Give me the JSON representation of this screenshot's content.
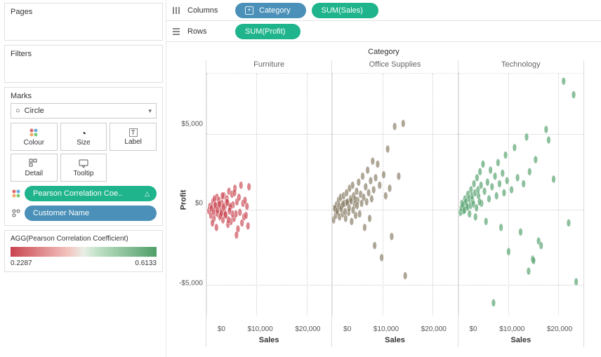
{
  "sidebar": {
    "pages_title": "Pages",
    "filters_title": "Filters",
    "marks_title": "Marks",
    "shape_selected": "Circle",
    "mark_buttons": {
      "colour": "Colour",
      "size": "Size",
      "label": "Label",
      "detail": "Detail",
      "tooltip": "Tooltip"
    },
    "colour_pill": "Pearson Correlation Coe..",
    "detail_pill": "Customer Name",
    "legend_title": "AGG(Pearson Correlation Coefficient)",
    "legend_min": "0.2287",
    "legend_max": "0.6133"
  },
  "shelves": {
    "columns_label": "Columns",
    "rows_label": "Rows",
    "columns_pills": [
      {
        "text": "Category",
        "style": "blue",
        "expand": true
      },
      {
        "text": "SUM(Sales)",
        "style": "green",
        "expand": false
      }
    ],
    "rows_pills": [
      {
        "text": "SUM(Profit)",
        "style": "green",
        "expand": false
      }
    ]
  },
  "viz": {
    "header": "Category",
    "facets": [
      "Furniture",
      "Office Supplies",
      "Technology"
    ],
    "y_title": "Profit",
    "y_ticks": [
      "$5,000",
      "$0",
      "-$5,000"
    ],
    "x_ticks": [
      "$0",
      "$10,000",
      "$20,000"
    ],
    "x_label": "Sales"
  },
  "chart_data": {
    "type": "scatter",
    "title": "Category",
    "xlabel": "Sales",
    "ylabel": "Profit",
    "xlim": [
      0,
      25000
    ],
    "ylim": [
      -7000,
      9000
    ],
    "facet_by": "Category",
    "colour_by": "Pearson Correlation Coefficient",
    "colour_scale": {
      "min": 0.2287,
      "max": 0.6133,
      "low_color": "#c9434f",
      "high_color": "#4f9e68"
    },
    "series": [
      {
        "name": "Furniture",
        "corr": 0.2287,
        "points": [
          [
            500,
            -100
          ],
          [
            700,
            200
          ],
          [
            900,
            -400
          ],
          [
            1100,
            100
          ],
          [
            1300,
            500
          ],
          [
            1500,
            -600
          ],
          [
            1700,
            300
          ],
          [
            1900,
            -200
          ],
          [
            2100,
            800
          ],
          [
            2300,
            -300
          ],
          [
            2500,
            600
          ],
          [
            2700,
            -500
          ],
          [
            2900,
            0
          ],
          [
            3100,
            400
          ],
          [
            3300,
            -700
          ],
          [
            3500,
            900
          ],
          [
            3700,
            200
          ],
          [
            3900,
            -400
          ],
          [
            4100,
            700
          ],
          [
            4300,
            -1000
          ],
          [
            4500,
            1200
          ],
          [
            4700,
            100
          ],
          [
            4900,
            -800
          ],
          [
            5100,
            1000
          ],
          [
            5300,
            300
          ],
          [
            5500,
            -600
          ],
          [
            5700,
            1400
          ],
          [
            5900,
            -300
          ],
          [
            6100,
            500
          ],
          [
            6300,
            -1300
          ],
          [
            6500,
            800
          ],
          [
            6700,
            -200
          ],
          [
            6900,
            1600
          ],
          [
            7100,
            -900
          ],
          [
            7300,
            400
          ],
          [
            7500,
            -500
          ],
          [
            7700,
            600
          ],
          [
            7900,
            -400
          ],
          [
            8100,
            200
          ],
          [
            8300,
            -1100
          ],
          [
            8500,
            1500
          ],
          [
            1200,
            -900
          ],
          [
            1600,
            700
          ],
          [
            2000,
            -1200
          ],
          [
            2400,
            300
          ],
          [
            2800,
            -400
          ],
          [
            3200,
            900
          ],
          [
            3600,
            -200
          ],
          [
            4000,
            500
          ],
          [
            4400,
            -700
          ],
          [
            4800,
            200
          ],
          [
            5200,
            -300
          ],
          [
            5600,
            1100
          ],
          [
            6000,
            -1700
          ],
          [
            1000,
            50
          ],
          [
            1400,
            -150
          ],
          [
            1800,
            250
          ],
          [
            2200,
            -50
          ],
          [
            2600,
            350
          ],
          [
            3000,
            -250
          ],
          [
            3400,
            150
          ],
          [
            3800,
            -350
          ],
          [
            4200,
            450
          ],
          [
            4600,
            -100
          ]
        ]
      },
      {
        "name": "Office Supplies",
        "corr": 0.45,
        "points": [
          [
            300,
            -700
          ],
          [
            500,
            100
          ],
          [
            700,
            -400
          ],
          [
            900,
            300
          ],
          [
            1100,
            -200
          ],
          [
            1300,
            600
          ],
          [
            1500,
            -500
          ],
          [
            1700,
            800
          ],
          [
            1900,
            200
          ],
          [
            2100,
            -300
          ],
          [
            2300,
            900
          ],
          [
            2500,
            400
          ],
          [
            2700,
            -600
          ],
          [
            2900,
            1100
          ],
          [
            3100,
            500
          ],
          [
            3300,
            -200
          ],
          [
            3500,
            1400
          ],
          [
            3700,
            700
          ],
          [
            3900,
            -800
          ],
          [
            4100,
            1600
          ],
          [
            4300,
            900
          ],
          [
            4500,
            300
          ],
          [
            4700,
            -400
          ],
          [
            4900,
            1200
          ],
          [
            5100,
            600
          ],
          [
            5300,
            1800
          ],
          [
            5500,
            -300
          ],
          [
            5700,
            1000
          ],
          [
            5900,
            400
          ],
          [
            6100,
            2200
          ],
          [
            6300,
            800
          ],
          [
            6500,
            -1200
          ],
          [
            6700,
            1500
          ],
          [
            6900,
            500
          ],
          [
            7100,
            2600
          ],
          [
            7300,
            1100
          ],
          [
            7500,
            -600
          ],
          [
            7700,
            1900
          ],
          [
            7900,
            700
          ],
          [
            8100,
            3200
          ],
          [
            8300,
            1300
          ],
          [
            8500,
            -2400
          ],
          [
            8700,
            2100
          ],
          [
            9100,
            3000
          ],
          [
            9500,
            1600
          ],
          [
            9900,
            -3200
          ],
          [
            10300,
            2300
          ],
          [
            10700,
            900
          ],
          [
            11100,
            4000
          ],
          [
            11500,
            1400
          ],
          [
            11900,
            -1800
          ],
          [
            12500,
            5500
          ],
          [
            13300,
            2200
          ],
          [
            14200,
            5700
          ],
          [
            14600,
            -4400
          ],
          [
            600,
            50
          ],
          [
            1000,
            -100
          ],
          [
            1400,
            200
          ],
          [
            1800,
            50
          ],
          [
            2200,
            350
          ],
          [
            2600,
            -150
          ],
          [
            3000,
            450
          ],
          [
            3400,
            100
          ],
          [
            3800,
            550
          ],
          [
            4200,
            -50
          ],
          [
            4600,
            650
          ],
          [
            5000,
            250
          ]
        ]
      },
      {
        "name": "Technology",
        "corr": 0.6133,
        "points": [
          [
            400,
            -200
          ],
          [
            700,
            400
          ],
          [
            1000,
            -100
          ],
          [
            1300,
            700
          ],
          [
            1600,
            200
          ],
          [
            1900,
            1000
          ],
          [
            2200,
            -300
          ],
          [
            2500,
            1300
          ],
          [
            2800,
            600
          ],
          [
            3100,
            1700
          ],
          [
            3400,
            -500
          ],
          [
            3700,
            2100
          ],
          [
            4000,
            900
          ],
          [
            4300,
            2500
          ],
          [
            4600,
            400
          ],
          [
            4900,
            3000
          ],
          [
            5200,
            1200
          ],
          [
            5500,
            -800
          ],
          [
            5800,
            1800
          ],
          [
            6100,
            700
          ],
          [
            6400,
            2600
          ],
          [
            6700,
            1500
          ],
          [
            7000,
            -6200
          ],
          [
            7300,
            2200
          ],
          [
            7600,
            900
          ],
          [
            7900,
            3100
          ],
          [
            8200,
            1700
          ],
          [
            8500,
            -1200
          ],
          [
            8800,
            2400
          ],
          [
            9100,
            1100
          ],
          [
            9400,
            3600
          ],
          [
            9700,
            1900
          ],
          [
            10000,
            -2800
          ],
          [
            10600,
            1300
          ],
          [
            11200,
            4100
          ],
          [
            11800,
            2100
          ],
          [
            12400,
            -1500
          ],
          [
            13000,
            1700
          ],
          [
            13600,
            4800
          ],
          [
            14200,
            2500
          ],
          [
            14800,
            -3300
          ],
          [
            15400,
            3300
          ],
          [
            16000,
            -2100
          ],
          [
            17500,
            5300
          ],
          [
            19000,
            2000
          ],
          [
            21000,
            8500
          ],
          [
            22000,
            -900
          ],
          [
            23000,
            7600
          ],
          [
            23500,
            -4800
          ],
          [
            14000,
            -4100
          ],
          [
            15000,
            -3400
          ],
          [
            16500,
            -2400
          ],
          [
            18000,
            4600
          ],
          [
            600,
            100
          ],
          [
            900,
            300
          ],
          [
            1200,
            -50
          ],
          [
            1500,
            500
          ],
          [
            1800,
            150
          ],
          [
            2100,
            700
          ],
          [
            2400,
            250
          ],
          [
            2700,
            900
          ],
          [
            3000,
            350
          ],
          [
            3300,
            1100
          ],
          [
            3600,
            100
          ],
          [
            3900,
            1300
          ],
          [
            4200,
            500
          ],
          [
            4500,
            1600
          ]
        ]
      }
    ]
  }
}
